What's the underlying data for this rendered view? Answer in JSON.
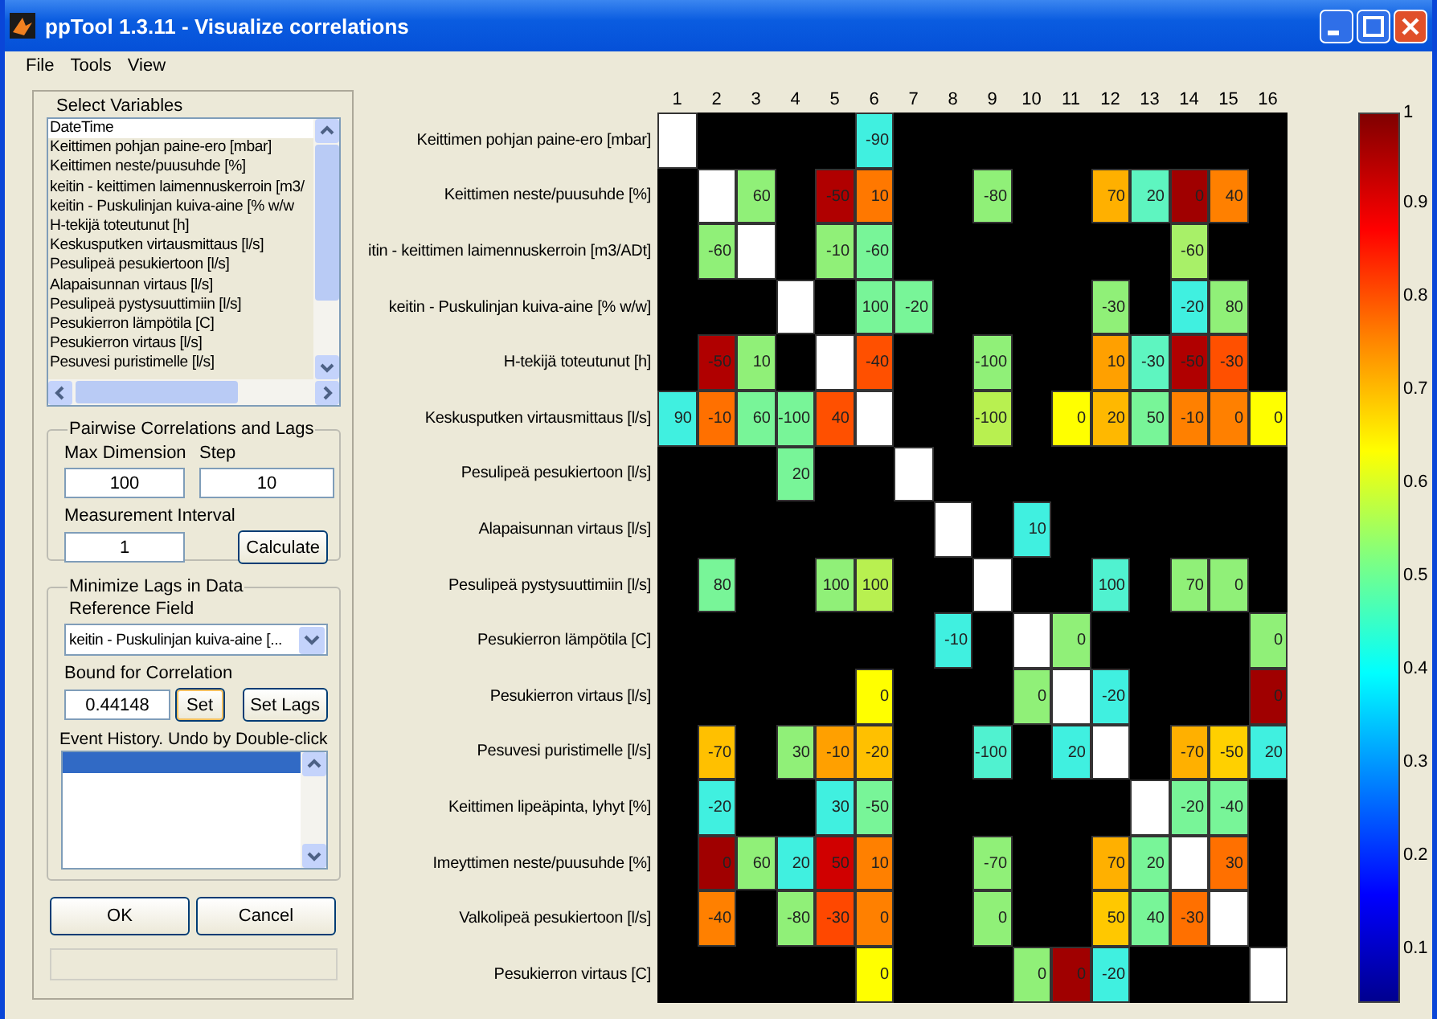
{
  "window": {
    "title": "ppTool 1.3.11 - Visualize correlations"
  },
  "menu": [
    "File",
    "Tools",
    "View"
  ],
  "select_variables": {
    "title": "Select Variables",
    "items": [
      {
        "label": "DateTime",
        "selected": true
      },
      {
        "label": "Keittimen pohjan paine-ero [mbar]",
        "selected": false
      },
      {
        "label": "Keittimen neste/puusuhde [%]",
        "selected": false
      },
      {
        "label": "keitin - keittimen laimennuskerroin [m3/",
        "selected": false
      },
      {
        "label": "keitin - Puskulinjan kuiva-aine [% w/w",
        "selected": false
      },
      {
        "label": "H-tekijä toteutunut [h]",
        "selected": false
      },
      {
        "label": "Keskusputken virtausmittaus [l/s]",
        "selected": false
      },
      {
        "label": "Pesulipeä pesukiertoon [l/s]",
        "selected": false
      },
      {
        "label": "Alapaisunnan virtaus [l/s]",
        "selected": false
      },
      {
        "label": "Pesulipeä pystysuuttimiin [l/s]",
        "selected": false
      },
      {
        "label": "Pesukierron lämpötila [C]",
        "selected": false
      },
      {
        "label": "Pesukierron virtaus [l/s]",
        "selected": false
      },
      {
        "label": "Pesuvesi puristimelle [l/s]",
        "selected": false
      }
    ]
  },
  "pairwise": {
    "title": "Pairwise Correlations and Lags",
    "max_dimension_label": "Max Dimension",
    "max_dimension": "100",
    "step_label": "Step",
    "step": "10",
    "interval_label": "Measurement Interval",
    "interval": "1",
    "calculate": "Calculate"
  },
  "minimize": {
    "title": "Minimize Lags in Data",
    "reference_label": "Reference Field",
    "reference": "keitin - Puskulinjan kuiva-aine [...",
    "bound_label": "Bound for Correlation",
    "bound": "0.44148",
    "set": "Set",
    "set_lags": "Set Lags",
    "history_label": "Event History. Undo by Double-click"
  },
  "buttons": {
    "ok": "OK",
    "cancel": "Cancel"
  },
  "heatmap": {
    "columns": [
      "1",
      "2",
      "3",
      "4",
      "5",
      "6",
      "7",
      "8",
      "9",
      "10",
      "11",
      "12",
      "13",
      "14",
      "15",
      "16"
    ],
    "rows": [
      {
        "label": "Keittimen pohjan paine-ero [mbar]",
        "cells": [
          {
            "color": "#ffffff"
          },
          {
            "color": "#000000"
          },
          {
            "color": "#000000"
          },
          {
            "color": "#000000"
          },
          {
            "color": "#000000"
          },
          {
            "color": "#40f0e0",
            "text": "-90"
          },
          {
            "color": "#000000"
          },
          {
            "color": "#000000"
          },
          {
            "color": "#000000"
          },
          {
            "color": "#000000"
          },
          {
            "color": "#000000"
          },
          {
            "color": "#000000"
          },
          {
            "color": "#000000"
          },
          {
            "color": "#000000"
          },
          {
            "color": "#000000"
          },
          {
            "color": "#000000"
          }
        ]
      },
      {
        "label": "Keittimen neste/puusuhde [%]",
        "cells": [
          {
            "color": "#000000"
          },
          {
            "color": "#ffffff"
          },
          {
            "color": "#90f078",
            "text": "60"
          },
          {
            "color": "#000000"
          },
          {
            "color": "#b00000",
            "text": "-50"
          },
          {
            "color": "#ff7800",
            "text": "10"
          },
          {
            "color": "#000000"
          },
          {
            "color": "#000000"
          },
          {
            "color": "#90f078",
            "text": "-80"
          },
          {
            "color": "#000000"
          },
          {
            "color": "#000000"
          },
          {
            "color": "#ffb000",
            "text": "70"
          },
          {
            "color": "#5ef5c0",
            "text": "20"
          },
          {
            "color": "#a00000",
            "text": "0"
          },
          {
            "color": "#ff8000",
            "text": "40"
          },
          {
            "color": "#000000"
          }
        ]
      },
      {
        "label": "itin - keittimen laimennuskerroin [m3/ADt]",
        "cells": [
          {
            "color": "#000000"
          },
          {
            "color": "#90f078",
            "text": "-60"
          },
          {
            "color": "#ffffff"
          },
          {
            "color": "#000000"
          },
          {
            "color": "#90f078",
            "text": "-10"
          },
          {
            "color": "#78f598",
            "text": "-60"
          },
          {
            "color": "#000000"
          },
          {
            "color": "#000000"
          },
          {
            "color": "#000000"
          },
          {
            "color": "#000000"
          },
          {
            "color": "#000000"
          },
          {
            "color": "#000000"
          },
          {
            "color": "#000000"
          },
          {
            "color": "#a8f068",
            "text": "-60"
          },
          {
            "color": "#000000"
          },
          {
            "color": "#000000"
          }
        ]
      },
      {
        "label": "keitin - Puskulinjan kuiva-aine [% w/w]",
        "cells": [
          {
            "color": "#000000"
          },
          {
            "color": "#000000"
          },
          {
            "color": "#000000"
          },
          {
            "color": "#ffffff"
          },
          {
            "color": "#000000"
          },
          {
            "color": "#78f598",
            "text": "100"
          },
          {
            "color": "#78f598",
            "text": "-20"
          },
          {
            "color": "#000000"
          },
          {
            "color": "#000000"
          },
          {
            "color": "#000000"
          },
          {
            "color": "#000000"
          },
          {
            "color": "#90f078",
            "text": "-30"
          },
          {
            "color": "#000000"
          },
          {
            "color": "#40f0e0",
            "text": "-20"
          },
          {
            "color": "#90f078",
            "text": "80"
          },
          {
            "color": "#000000"
          }
        ]
      },
      {
        "label": "H-tekijä toteutunut [h]",
        "cells": [
          {
            "color": "#000000"
          },
          {
            "color": "#b00000",
            "text": "-50"
          },
          {
            "color": "#90f078",
            "text": "10"
          },
          {
            "color": "#000000"
          },
          {
            "color": "#ffffff"
          },
          {
            "color": "#ff5000",
            "text": "-40"
          },
          {
            "color": "#000000"
          },
          {
            "color": "#000000"
          },
          {
            "color": "#90f078",
            "text": "-100"
          },
          {
            "color": "#000000"
          },
          {
            "color": "#000000"
          },
          {
            "color": "#ffa000",
            "text": "10"
          },
          {
            "color": "#5ef5c0",
            "text": "-30"
          },
          {
            "color": "#b00000",
            "text": "-50"
          },
          {
            "color": "#ff5000",
            "text": "-30"
          },
          {
            "color": "#000000"
          }
        ]
      },
      {
        "label": "Keskusputken virtausmittaus [l/s]",
        "cells": [
          {
            "color": "#40f0e0",
            "text": "90"
          },
          {
            "color": "#ff7000",
            "text": "-10"
          },
          {
            "color": "#78f598",
            "text": "60"
          },
          {
            "color": "#78f598",
            "text": "-100"
          },
          {
            "color": "#ff5000",
            "text": "40"
          },
          {
            "color": "#ffffff"
          },
          {
            "color": "#000000"
          },
          {
            "color": "#000000"
          },
          {
            "color": "#b8f050",
            "text": "-100"
          },
          {
            "color": "#000000"
          },
          {
            "color": "#ffff00",
            "text": "0"
          },
          {
            "color": "#ffb800",
            "text": "20"
          },
          {
            "color": "#78f598",
            "text": "50"
          },
          {
            "color": "#ff8000",
            "text": "-10"
          },
          {
            "color": "#ff8000",
            "text": "0"
          },
          {
            "color": "#ffff00",
            "text": "0"
          }
        ]
      },
      {
        "label": "Pesulipeä pesukiertoon [l/s]",
        "cells": [
          {
            "color": "#000000"
          },
          {
            "color": "#000000"
          },
          {
            "color": "#000000"
          },
          {
            "color": "#78f598",
            "text": "20"
          },
          {
            "color": "#000000"
          },
          {
            "color": "#000000"
          },
          {
            "color": "#ffffff"
          },
          {
            "color": "#000000"
          },
          {
            "color": "#000000"
          },
          {
            "color": "#000000"
          },
          {
            "color": "#000000"
          },
          {
            "color": "#000000"
          },
          {
            "color": "#000000"
          },
          {
            "color": "#000000"
          },
          {
            "color": "#000000"
          },
          {
            "color": "#000000"
          }
        ]
      },
      {
        "label": "Alapaisunnan virtaus [l/s]",
        "cells": [
          {
            "color": "#000000"
          },
          {
            "color": "#000000"
          },
          {
            "color": "#000000"
          },
          {
            "color": "#000000"
          },
          {
            "color": "#000000"
          },
          {
            "color": "#000000"
          },
          {
            "color": "#000000"
          },
          {
            "color": "#ffffff"
          },
          {
            "color": "#000000"
          },
          {
            "color": "#40f0e0",
            "text": "10"
          },
          {
            "color": "#000000"
          },
          {
            "color": "#000000"
          },
          {
            "color": "#000000"
          },
          {
            "color": "#000000"
          },
          {
            "color": "#000000"
          },
          {
            "color": "#000000"
          }
        ]
      },
      {
        "label": "Pesulipeä pystysuuttimiin [l/s]",
        "cells": [
          {
            "color": "#000000"
          },
          {
            "color": "#78f598",
            "text": "80"
          },
          {
            "color": "#000000"
          },
          {
            "color": "#000000"
          },
          {
            "color": "#90f078",
            "text": "100"
          },
          {
            "color": "#b8f050",
            "text": "100"
          },
          {
            "color": "#000000"
          },
          {
            "color": "#000000"
          },
          {
            "color": "#ffffff"
          },
          {
            "color": "#000000"
          },
          {
            "color": "#000000"
          },
          {
            "color": "#50f2d0",
            "text": "100"
          },
          {
            "color": "#000000"
          },
          {
            "color": "#90f078",
            "text": "70"
          },
          {
            "color": "#90f078",
            "text": "0"
          },
          {
            "color": "#000000"
          }
        ]
      },
      {
        "label": "Pesukierron lämpötila [C]",
        "cells": [
          {
            "color": "#000000"
          },
          {
            "color": "#000000"
          },
          {
            "color": "#000000"
          },
          {
            "color": "#000000"
          },
          {
            "color": "#000000"
          },
          {
            "color": "#000000"
          },
          {
            "color": "#000000"
          },
          {
            "color": "#40f0e0",
            "text": "-10"
          },
          {
            "color": "#000000"
          },
          {
            "color": "#ffffff"
          },
          {
            "color": "#90f078",
            "text": "0"
          },
          {
            "color": "#000000"
          },
          {
            "color": "#000000"
          },
          {
            "color": "#000000"
          },
          {
            "color": "#000000"
          },
          {
            "color": "#90f078",
            "text": "0"
          }
        ]
      },
      {
        "label": "Pesukierron virtaus [l/s]",
        "cells": [
          {
            "color": "#000000"
          },
          {
            "color": "#000000"
          },
          {
            "color": "#000000"
          },
          {
            "color": "#000000"
          },
          {
            "color": "#000000"
          },
          {
            "color": "#ffff00",
            "text": "0"
          },
          {
            "color": "#000000"
          },
          {
            "color": "#000000"
          },
          {
            "color": "#000000"
          },
          {
            "color": "#90f078",
            "text": "0"
          },
          {
            "color": "#ffffff"
          },
          {
            "color": "#40f0e0",
            "text": "-20"
          },
          {
            "color": "#000000"
          },
          {
            "color": "#000000"
          },
          {
            "color": "#000000"
          },
          {
            "color": "#a00000",
            "text": "0"
          }
        ]
      },
      {
        "label": "Pesuvesi puristimelle [l/s]",
        "cells": [
          {
            "color": "#000000"
          },
          {
            "color": "#ffc000",
            "text": "-70"
          },
          {
            "color": "#000000"
          },
          {
            "color": "#90f078",
            "text": "30"
          },
          {
            "color": "#ffa000",
            "text": "-10"
          },
          {
            "color": "#ffc000",
            "text": "-20"
          },
          {
            "color": "#000000"
          },
          {
            "color": "#000000"
          },
          {
            "color": "#50f2d0",
            "text": "-100"
          },
          {
            "color": "#000000"
          },
          {
            "color": "#40f0e0",
            "text": "20"
          },
          {
            "color": "#ffffff"
          },
          {
            "color": "#000000"
          },
          {
            "color": "#ffb000",
            "text": "-70"
          },
          {
            "color": "#ffd000",
            "text": "-50"
          },
          {
            "color": "#40f0e0",
            "text": "20"
          }
        ]
      },
      {
        "label": "Keittimen lipeäpinta, lyhyt [%]",
        "cells": [
          {
            "color": "#000000"
          },
          {
            "color": "#40f0e0",
            "text": "-20"
          },
          {
            "color": "#000000"
          },
          {
            "color": "#000000"
          },
          {
            "color": "#40f0e0",
            "text": "30"
          },
          {
            "color": "#78f598",
            "text": "-50"
          },
          {
            "color": "#000000"
          },
          {
            "color": "#000000"
          },
          {
            "color": "#000000"
          },
          {
            "color": "#000000"
          },
          {
            "color": "#000000"
          },
          {
            "color": "#000000"
          },
          {
            "color": "#ffffff"
          },
          {
            "color": "#78f598",
            "text": "-20"
          },
          {
            "color": "#78f598",
            "text": "-40"
          },
          {
            "color": "#000000"
          }
        ]
      },
      {
        "label": "Imeyttimen neste/puusuhde [%]",
        "cells": [
          {
            "color": "#000000"
          },
          {
            "color": "#a00000",
            "text": "0"
          },
          {
            "color": "#90f078",
            "text": "60"
          },
          {
            "color": "#40f0e0",
            "text": "20"
          },
          {
            "color": "#d00000",
            "text": "50"
          },
          {
            "color": "#ff8000",
            "text": "10"
          },
          {
            "color": "#000000"
          },
          {
            "color": "#000000"
          },
          {
            "color": "#90f078",
            "text": "-70"
          },
          {
            "color": "#000000"
          },
          {
            "color": "#000000"
          },
          {
            "color": "#ffb000",
            "text": "70"
          },
          {
            "color": "#78f598",
            "text": "20"
          },
          {
            "color": "#ffffff"
          },
          {
            "color": "#ff7000",
            "text": "30"
          },
          {
            "color": "#000000"
          }
        ]
      },
      {
        "label": "Valkolipeä pesukiertoon [l/s]",
        "cells": [
          {
            "color": "#000000"
          },
          {
            "color": "#ff8000",
            "text": "-40"
          },
          {
            "color": "#000000"
          },
          {
            "color": "#90f078",
            "text": "-80"
          },
          {
            "color": "#ff4800",
            "text": "-30"
          },
          {
            "color": "#ff8000",
            "text": "0"
          },
          {
            "color": "#000000"
          },
          {
            "color": "#000000"
          },
          {
            "color": "#90f078",
            "text": "0"
          },
          {
            "color": "#000000"
          },
          {
            "color": "#000000"
          },
          {
            "color": "#ffc800",
            "text": "50"
          },
          {
            "color": "#78f598",
            "text": "40"
          },
          {
            "color": "#ff7000",
            "text": "-30"
          },
          {
            "color": "#ffffff"
          },
          {
            "color": "#000000"
          }
        ]
      },
      {
        "label": "Pesukierron virtaus [C]",
        "cells": [
          {
            "color": "#000000"
          },
          {
            "color": "#000000"
          },
          {
            "color": "#000000"
          },
          {
            "color": "#000000"
          },
          {
            "color": "#000000"
          },
          {
            "color": "#ffff00",
            "text": "0"
          },
          {
            "color": "#000000"
          },
          {
            "color": "#000000"
          },
          {
            "color": "#000000"
          },
          {
            "color": "#90f078",
            "text": "0"
          },
          {
            "color": "#a00000",
            "text": "0"
          },
          {
            "color": "#40f0e0",
            "text": "-20"
          },
          {
            "color": "#000000"
          },
          {
            "color": "#000000"
          },
          {
            "color": "#000000"
          },
          {
            "color": "#ffffff"
          }
        ]
      }
    ]
  },
  "colorbar": {
    "ticks": [
      "1",
      "0.9",
      "0.8",
      "0.7",
      "0.6",
      "0.5",
      "0.4",
      "0.3",
      "0.2",
      "0.1"
    ]
  }
}
